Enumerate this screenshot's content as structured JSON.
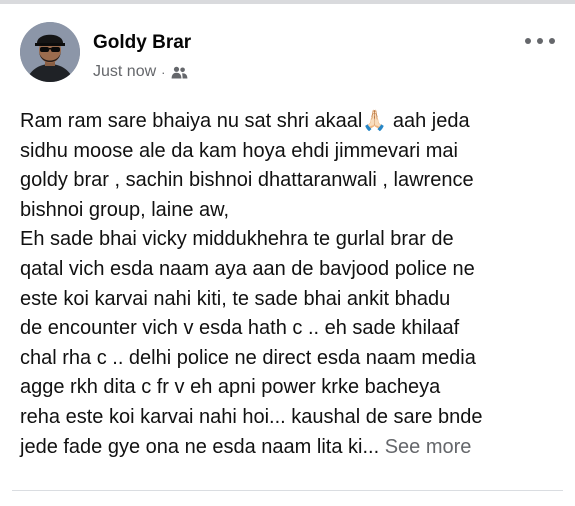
{
  "post": {
    "author": "Goldy Brar",
    "time": "Just now",
    "separator": "·",
    "audience_icon": "friends-icon",
    "more_icon": "more-options-icon",
    "body_lines": [
      "Ram ram sare bhaiya nu sat shri akaal",
      "sidhu moose ale da kam hoya ehdi jimmevari mai",
      "goldy brar , sachin bishnoi dhattaranwali , lawrence",
      "bishnoi group,  laine aw,",
      "Eh sade bhai vicky middukhehra te gurlal brar de",
      "qatal vich esda naam aya aan de bavjood police ne",
      "este koi karvai nahi kiti, te sade bhai ankit bhadu",
      "de encounter vich v esda hath c .. eh sade khilaaf",
      "chal rha c .. delhi police ne direct esda naam media",
      "agge rkh dita c fr v eh apni power krke bacheya",
      "reha este koi karvai nahi hoi... kaushal de sare bnde",
      "jede fade gye ona ne esda naam lita ki..."
    ],
    "line1_emoji": "🙏🏻",
    "line1_tail": " aah jeda",
    "see_more": "See more"
  },
  "colors": {
    "text": "#050505",
    "secondary": "#65676b",
    "divider": "#dadde1"
  }
}
